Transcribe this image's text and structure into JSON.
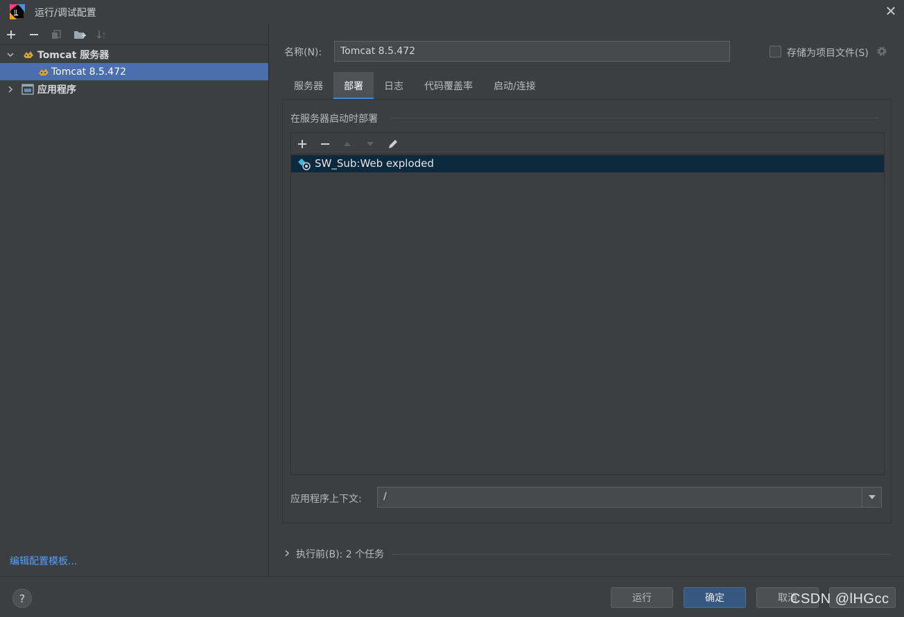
{
  "window": {
    "title": "运行/调试配置",
    "close_icon": "close-icon",
    "app_icon": "intellij-idea-icon"
  },
  "sidebar": {
    "toolbar": [
      {
        "name": "add-icon",
        "glyph": "+",
        "enabled": true
      },
      {
        "name": "remove-icon",
        "glyph": "−",
        "enabled": true
      },
      {
        "name": "copy-icon",
        "glyph": "⧉",
        "enabled": false
      },
      {
        "name": "new-folder-icon",
        "glyph": "📁",
        "enabled": true
      },
      {
        "name": "sort-icon",
        "glyph": "↓",
        "enabled": false
      }
    ],
    "tree": [
      {
        "label": "Tomcat 服务器",
        "expanded": true
      },
      {
        "label": "Tomcat 8.5.472",
        "selected": true
      },
      {
        "label": "应用程序",
        "expanded": false
      }
    ],
    "edit_templates_link": "编辑配置模板..."
  },
  "config": {
    "name_label": "名称(N):",
    "name_value": "Tomcat 8.5.472",
    "store_as_project_file_label": "存储为项目文件(S)",
    "store_as_project_file_checked": false
  },
  "tabs": [
    {
      "label": "服务器",
      "active": false
    },
    {
      "label": "部署",
      "active": true
    },
    {
      "label": "日志",
      "active": false
    },
    {
      "label": "代码覆盖率",
      "active": false
    },
    {
      "label": "启动/连接",
      "active": false
    }
  ],
  "deployment": {
    "section_title": "在服务器启动时部署",
    "toolbar": [
      {
        "name": "add-icon",
        "enabled": true
      },
      {
        "name": "remove-icon",
        "enabled": true
      },
      {
        "name": "move-up-icon",
        "enabled": false
      },
      {
        "name": "move-down-icon",
        "enabled": false
      },
      {
        "name": "edit-pencil-icon",
        "enabled": true
      }
    ],
    "items": [
      {
        "label": "SW_Sub:Web exploded",
        "selected": true
      }
    ],
    "context_label": "应用程序上下文:",
    "context_value": "/"
  },
  "before_launch": {
    "label": "执行前(B): 2 个任务"
  },
  "footer": {
    "help_label": "?",
    "run_label": "运行",
    "ok_label": "确定",
    "cancel_label": "取消",
    "watermark": "CSDN @lHGcc"
  },
  "colors": {
    "background": "#3c3f41",
    "selection": "#4b6eaf",
    "list_selection": "#0d293e",
    "primary_button": "#365880",
    "link": "#589df6",
    "tab_underline": "#4a88c7"
  }
}
